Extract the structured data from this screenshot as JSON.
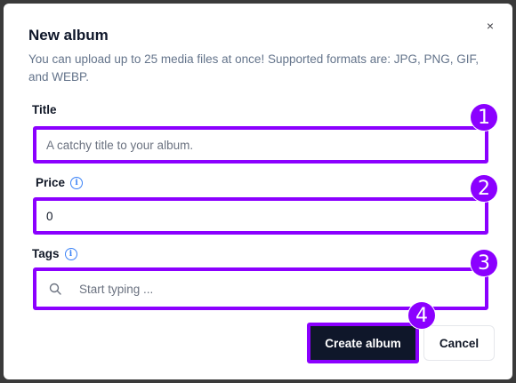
{
  "dialog": {
    "title": "New album",
    "description": "You can upload up to 25 media files at once! Supported formats are: JPG, PNG, GIF, and WEBP.",
    "close_label": "×"
  },
  "form": {
    "title_label": "Title",
    "title_placeholder": "A catchy title to your album.",
    "price_label": "Price",
    "price_value": "0",
    "tags_label": "Tags",
    "tags_placeholder": "Start typing ..."
  },
  "info_icon": {
    "glyph": "i",
    "icon": "info-icon"
  },
  "buttons": {
    "create_label": "Create album",
    "cancel_label": "Cancel"
  },
  "badges": [
    "1",
    "2",
    "3",
    "4"
  ],
  "colors": {
    "highlight": "#8b00ff",
    "primary_button": "#0f172a",
    "info": "#3b82f6",
    "muted_text": "#64748b"
  }
}
